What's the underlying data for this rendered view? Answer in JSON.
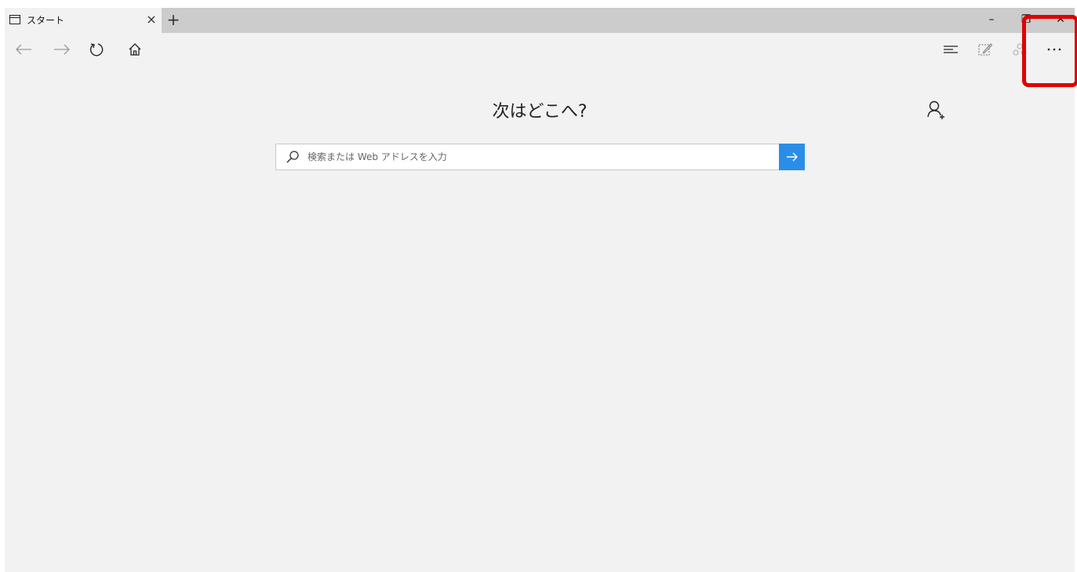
{
  "tab": {
    "title": "スタート",
    "close_glyph": "×",
    "new_tab_glyph": "+"
  },
  "window_controls": {
    "minimize_glyph": "–",
    "restore_glyph": "❐",
    "close_glyph": "✕"
  },
  "page": {
    "heading": "次はどこへ?",
    "search_placeholder": "検索または Web アドレスを入力",
    "search_value": ""
  },
  "icons": {
    "back": "back-arrow-icon",
    "forward": "forward-arrow-icon",
    "refresh": "refresh-icon",
    "home": "home-icon",
    "hub": "hub-icon",
    "web_note": "web-note-icon",
    "share": "share-icon",
    "more": "more-icon",
    "add_user": "add-user-icon",
    "search": "search-icon",
    "go": "go-arrow-icon"
  },
  "colors": {
    "accent": "#2a8ee8",
    "highlight": "#e00000",
    "background": "#f2f2f2",
    "titlebar": "#cccccc"
  }
}
